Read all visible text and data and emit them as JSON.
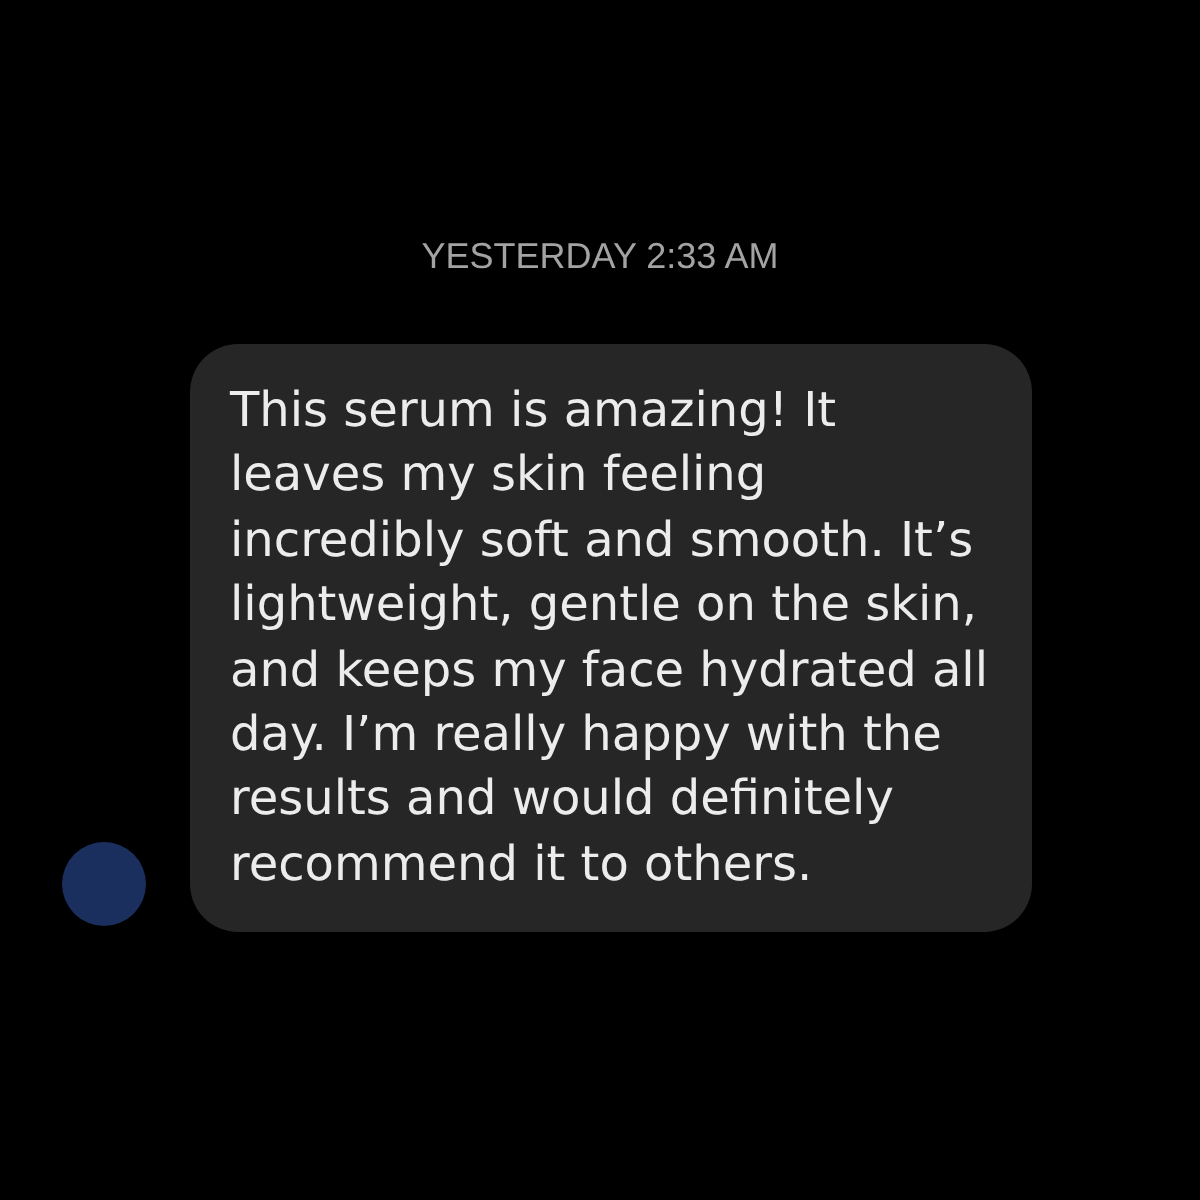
{
  "timestamp": "YESTERDAY 2:33 AM",
  "messages": [
    {
      "text": "This serum is amazing! It leaves my skin feeling incredibly soft and smooth. It’s lightweight, gentle on the skin, and keeps my face hydrated all day. I’m really happy with the results and would definitely recommend it to others."
    }
  ]
}
